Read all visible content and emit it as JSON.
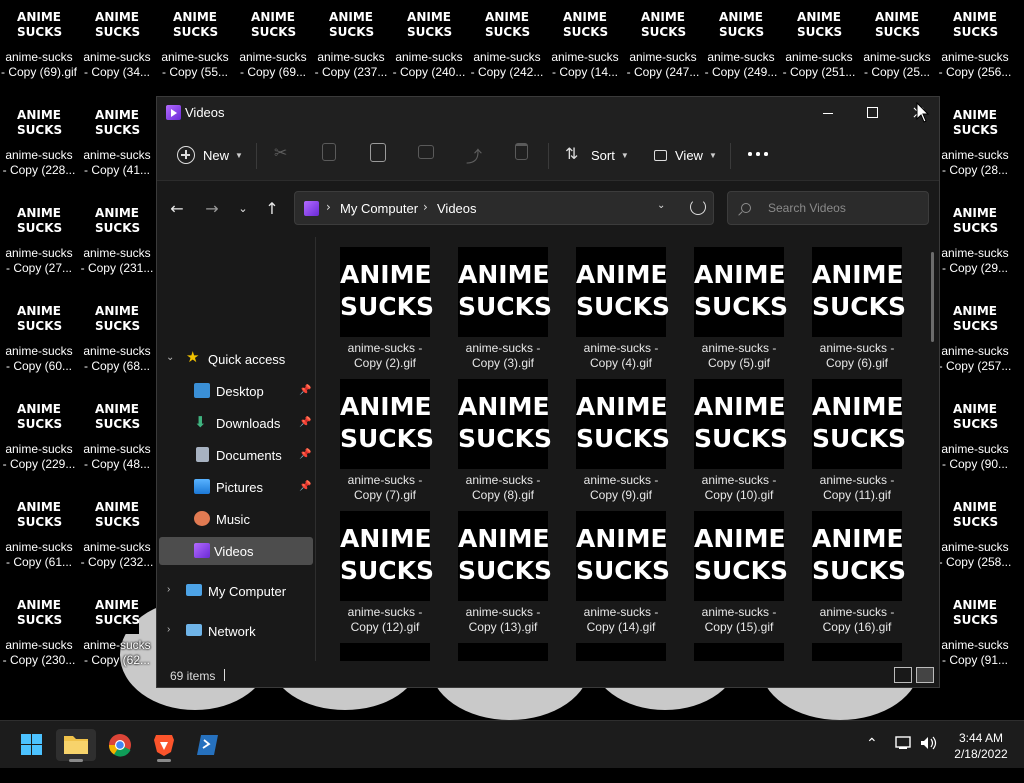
{
  "desktop": {
    "thumb_text": [
      "ANIME",
      "SUCKS"
    ],
    "icons": [
      {
        "line1": "anime-sucks",
        "line2": "- Copy (69).gif"
      },
      {
        "line1": "anime-sucks",
        "line2": "- Copy (34..."
      },
      {
        "line1": "anime-sucks",
        "line2": "- Copy (55..."
      },
      {
        "line1": "anime-sucks",
        "line2": "- Copy (69..."
      },
      {
        "line1": "anime-sucks",
        "line2": "- Copy (237..."
      },
      {
        "line1": "anime-sucks",
        "line2": "- Copy (240..."
      },
      {
        "line1": "anime-sucks",
        "line2": "- Copy (242..."
      },
      {
        "line1": "anime-sucks",
        "line2": "- Copy (14..."
      },
      {
        "line1": "anime-sucks",
        "line2": "- Copy (247..."
      },
      {
        "line1": "anime-sucks",
        "line2": "- Copy (249..."
      },
      {
        "line1": "anime-sucks",
        "line2": "- Copy (251..."
      },
      {
        "line1": "anime-sucks",
        "line2": "- Copy (25..."
      },
      {
        "line1": "anime-sucks",
        "line2": "- Copy (256..."
      },
      {
        "line1": "anime-sucks",
        "line2": "- Copy (228..."
      },
      {
        "line1": "anime-sucks",
        "line2": "- Copy (41..."
      },
      {
        "line1": "anime-sucks",
        "line2": "- Copy (28..."
      },
      {
        "line1": "anime-sucks",
        "line2": "- Copy (27..."
      },
      {
        "line1": "anime-sucks",
        "line2": "- Copy (231..."
      },
      {
        "line1": "anime-sucks",
        "line2": "- Copy (29..."
      },
      {
        "line1": "anime-sucks",
        "line2": "- Copy (60..."
      },
      {
        "line1": "anime-sucks",
        "line2": "- Copy (68..."
      },
      {
        "line1": "anime-sucks",
        "line2": "- Copy (257..."
      },
      {
        "line1": "anime-sucks",
        "line2": "- Copy (229..."
      },
      {
        "line1": "anime-sucks",
        "line2": "- Copy (48..."
      },
      {
        "line1": "anime-sucks",
        "line2": "- Copy (90..."
      },
      {
        "line1": "anime-sucks",
        "line2": "- Copy (61..."
      },
      {
        "line1": "anime-sucks",
        "line2": "- Copy (232..."
      },
      {
        "line1": "anime-sucks",
        "line2": "- Copy (258..."
      },
      {
        "line1": "anime-sucks",
        "line2": "- Copy (230..."
      },
      {
        "line1": "anime-sucks",
        "line2": "- Copy (62..."
      },
      {
        "line1": "anime-sucks",
        "line2": "- Copy (91..."
      }
    ]
  },
  "window": {
    "title": "Videos",
    "toolbar": {
      "new_label": "New",
      "sort_label": "Sort",
      "view_label": "View"
    },
    "address": {
      "root": "My Computer",
      "current": "Videos"
    },
    "search": {
      "placeholder": "Search Videos"
    },
    "nav": {
      "quick_access": "Quick access",
      "items": [
        "Desktop",
        "Downloads",
        "Documents",
        "Pictures",
        "Music",
        "Videos"
      ],
      "my_computer": "My Computer",
      "network": "Network"
    },
    "files": {
      "thumb_text": [
        "ANIME",
        "SUCKS"
      ],
      "items": [
        {
          "line1": "anime-sucks -",
          "line2": "Copy (2).gif"
        },
        {
          "line1": "anime-sucks -",
          "line2": "Copy (3).gif"
        },
        {
          "line1": "anime-sucks -",
          "line2": "Copy (4).gif"
        },
        {
          "line1": "anime-sucks -",
          "line2": "Copy (5).gif"
        },
        {
          "line1": "anime-sucks -",
          "line2": "Copy (6).gif"
        },
        {
          "line1": "anime-sucks -",
          "line2": "Copy (7).gif"
        },
        {
          "line1": "anime-sucks -",
          "line2": "Copy (8).gif"
        },
        {
          "line1": "anime-sucks -",
          "line2": "Copy (9).gif"
        },
        {
          "line1": "anime-sucks -",
          "line2": "Copy (10).gif"
        },
        {
          "line1": "anime-sucks -",
          "line2": "Copy (11).gif"
        },
        {
          "line1": "anime-sucks -",
          "line2": "Copy (12).gif"
        },
        {
          "line1": "anime-sucks -",
          "line2": "Copy (13).gif"
        },
        {
          "line1": "anime-sucks -",
          "line2": "Copy (14).gif"
        },
        {
          "line1": "anime-sucks -",
          "line2": "Copy (15).gif"
        },
        {
          "line1": "anime-sucks -",
          "line2": "Copy (16).gif"
        }
      ]
    },
    "status": {
      "item_count": "69 items"
    }
  },
  "taskbar": {
    "time": "3:44 AM",
    "date": "2/18/2022"
  }
}
